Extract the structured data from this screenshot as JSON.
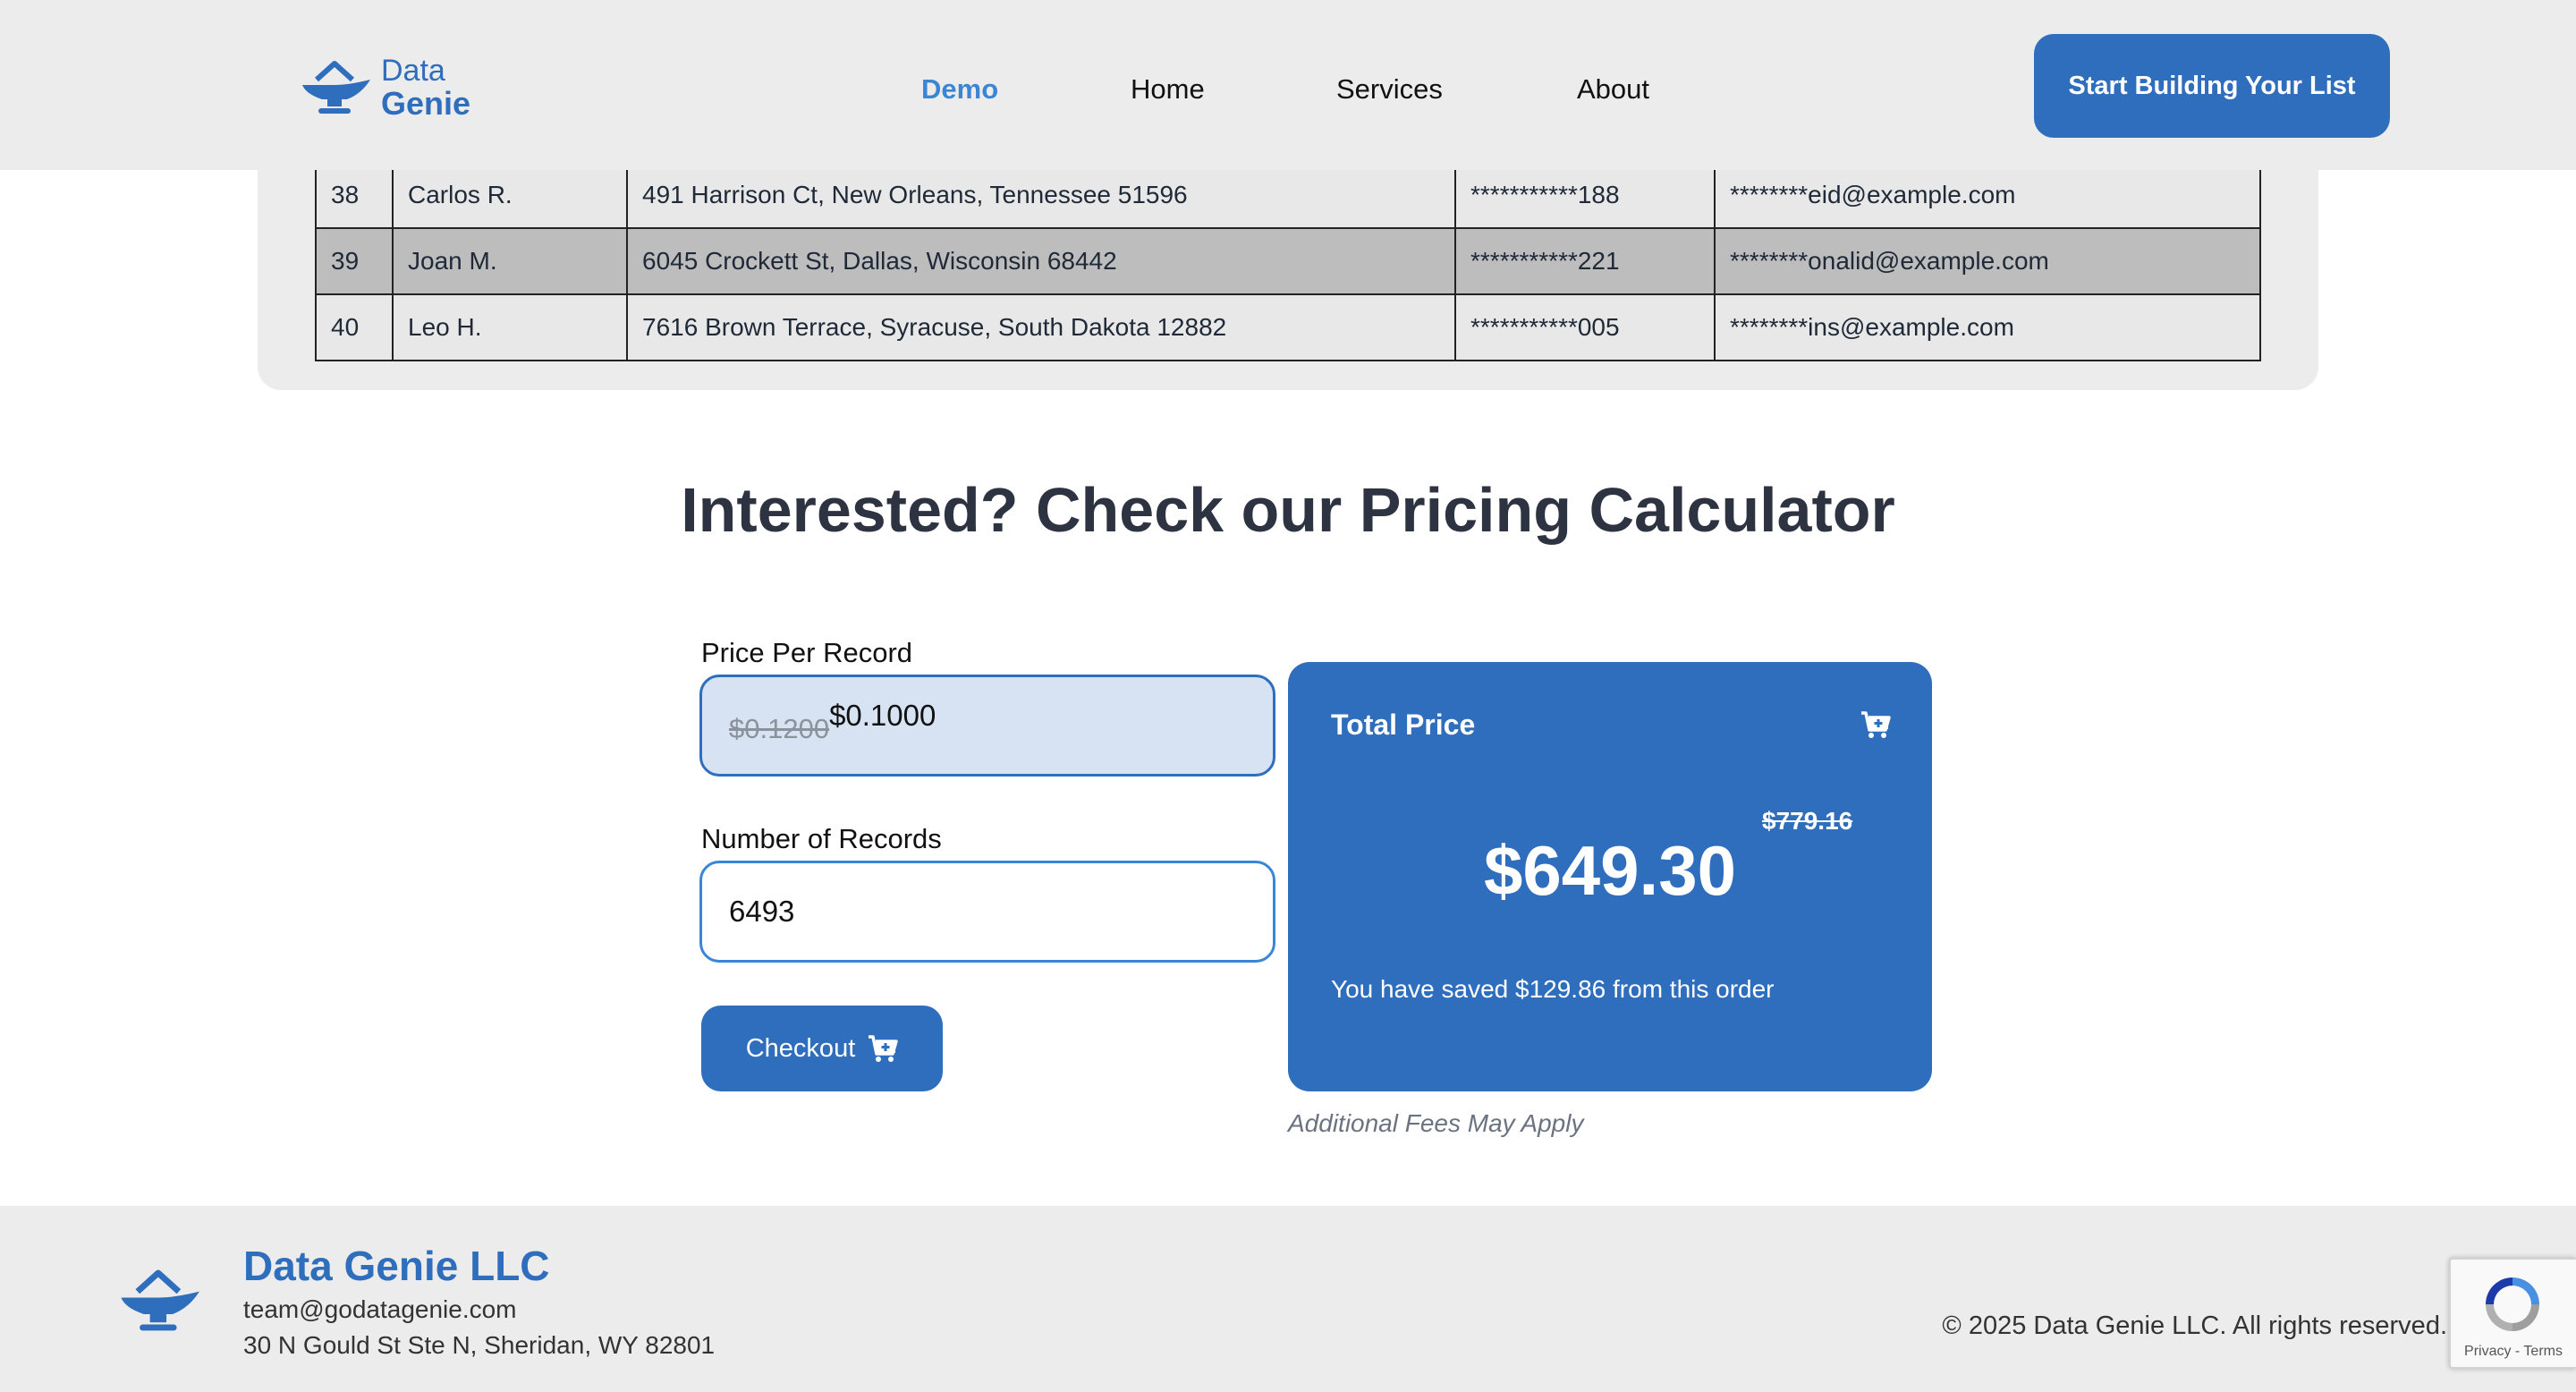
{
  "header": {
    "logo_line1": "Data",
    "logo_line2": "Genie",
    "nav": [
      {
        "label": "Demo",
        "active": true
      },
      {
        "label": "Home"
      },
      {
        "label": "Services"
      },
      {
        "label": "About"
      }
    ],
    "cta_label": "Start Building Your List"
  },
  "table": {
    "rows": [
      {
        "id": "38",
        "name": "Carlos R.",
        "address": "491 Harrison Ct, New Orleans, Tennessee 51596",
        "phone": "***********188",
        "email": "********eid@example.com"
      },
      {
        "id": "39",
        "name": "Joan M.",
        "address": "6045 Crockett St, Dallas, Wisconsin 68442",
        "phone": "***********221",
        "email": "********onalid@example.com"
      },
      {
        "id": "40",
        "name": "Leo H.",
        "address": "7616 Brown Terrace, Syracuse, South Dakota 12882",
        "phone": "***********005",
        "email": "********ins@example.com"
      }
    ]
  },
  "pricing": {
    "heading": "Interested? Check our Pricing Calculator",
    "price_label": "Price Per Record",
    "old_price": "$0.1200",
    "new_price": "$0.1000",
    "records_label": "Number of Records",
    "records_value": "6493",
    "checkout_label": "Checkout",
    "total_label": "Total Price",
    "old_total": "$779.16",
    "new_total": "$649.30",
    "saved_text": "You have saved $129.86 from this order",
    "fees_note": "Additional Fees May Apply"
  },
  "footer": {
    "company": "Data Genie LLC",
    "email": "team@godatagenie.com",
    "address": "30 N Gould St Ste N, Sheridan, WY 82801",
    "copyright": "© 2025 Data Genie LLC. All rights reserved."
  },
  "recaptcha": {
    "links": "Privacy - Terms"
  },
  "icons": {
    "logo": "genie-lamp-icon",
    "cart": "cart-plus-icon",
    "recaptcha": "recaptcha-icon"
  },
  "colors": {
    "brand_blue": "#2f6dbd",
    "nav_active": "#3a86d6",
    "header_bg": "#ececec",
    "heading_text": "#2d3340"
  }
}
